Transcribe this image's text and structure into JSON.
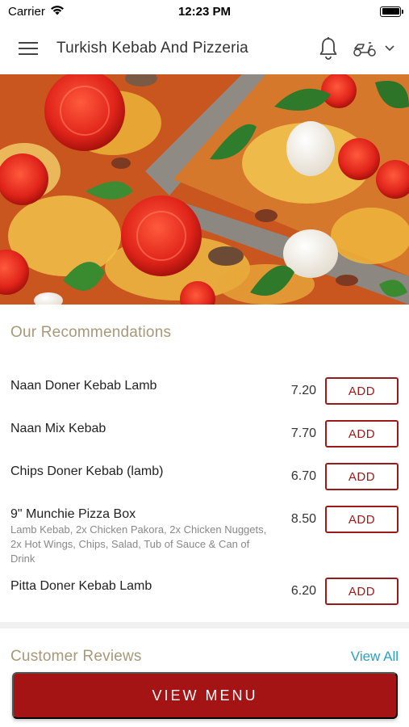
{
  "status_bar": {
    "carrier": "Carrier",
    "time": "12:23 PM",
    "battery_level": 1.0
  },
  "header": {
    "title": "Turkish Kebab And Pizzeria",
    "icons": [
      "hamburger-menu-icon",
      "bell-icon",
      "scooter-icon",
      "chevron-down-icon"
    ]
  },
  "hero": {
    "image": "pizza-slices"
  },
  "recommendations": {
    "title": "Our Recommendations",
    "add_label": "ADD",
    "items": [
      {
        "name": "Naan Doner Kebab Lamb",
        "price": "7.20",
        "description": ""
      },
      {
        "name": "Naan Mix Kebab",
        "price": "7.70",
        "description": ""
      },
      {
        "name": "Chips Doner Kebab (lamb)",
        "price": "6.70",
        "description": ""
      },
      {
        "name": "9\" Munchie Pizza Box",
        "price": "8.50",
        "description": "Lamb Kebab, 2x Chicken Pakora, 2x Chicken Nuggets, 2x Hot Wings, Chips, Salad, Tub of Sauce & Can of Drink"
      },
      {
        "name": "Pitta Doner Kebab Lamb",
        "price": "6.20",
        "description": ""
      }
    ]
  },
  "reviews": {
    "title": "Customer Reviews",
    "view_all": "View All"
  },
  "footer": {
    "view_menu": "VIEW MENU"
  },
  "colors": {
    "accent": "#a51414",
    "section_title": "#a8987a",
    "link": "#2a9fc0"
  }
}
